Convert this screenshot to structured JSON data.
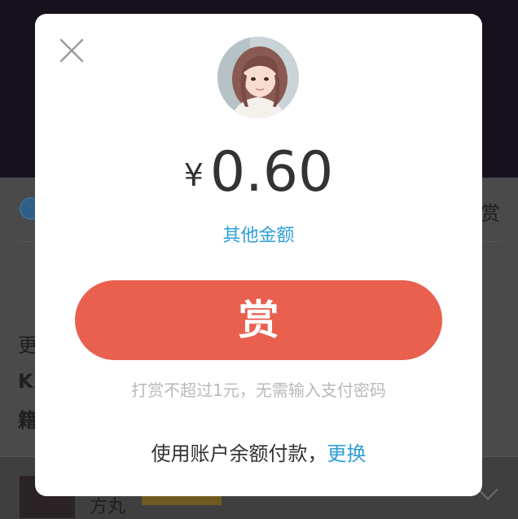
{
  "background": {
    "partial_char_right": "赏",
    "partial_char_left_1": "更",
    "partial_char_left_2": "K",
    "partial_char_left_3": "籍",
    "partial_name": "方丸"
  },
  "dialog": {
    "currency_symbol": "¥",
    "amount": "0.60",
    "other_amount_label": "其他金额",
    "reward_button_label": "赏",
    "hint": "打赏不超过1元，无需输入支付密码",
    "payment_text": "使用账户余额付款，",
    "payment_change_label": "更换"
  },
  "icons": {
    "close": "close-icon",
    "avatar": "author-avatar"
  },
  "colors": {
    "accent": "#e9604f",
    "link": "#2e9fd8",
    "hint": "#b9b9b9",
    "text": "#333333"
  }
}
